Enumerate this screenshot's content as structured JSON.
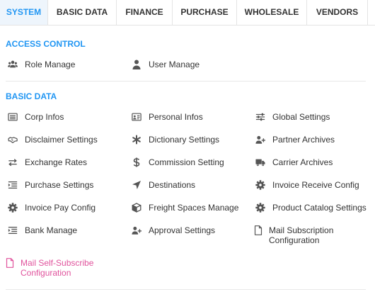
{
  "tabs": [
    {
      "label": "SYSTEM",
      "active": true
    },
    {
      "label": "BASIC DATA"
    },
    {
      "label": "FINANCE"
    },
    {
      "label": "PURCHASE"
    },
    {
      "label": "WHOLESALE"
    },
    {
      "label": "VENDORS"
    }
  ],
  "access_control": {
    "title": "ACCESS CONTROL",
    "items": [
      {
        "label": "Role Manage",
        "icon": "users-icon"
      },
      {
        "label": "User Manage",
        "icon": "user-icon"
      }
    ]
  },
  "basic_data": {
    "title": "BASIC DATA",
    "items": [
      {
        "label": "Corp Infos",
        "icon": "list-icon"
      },
      {
        "label": "Personal Infos",
        "icon": "id-card-icon"
      },
      {
        "label": "Global Settings",
        "icon": "sliders-icon"
      },
      {
        "label": "Disclaimer Settings",
        "icon": "handshake-icon"
      },
      {
        "label": "Dictionary Settings",
        "icon": "asterisk-icon"
      },
      {
        "label": "Partner Archives",
        "icon": "user-plus-icon"
      },
      {
        "label": "Exchange Rates",
        "icon": "exchange-icon"
      },
      {
        "label": "Commission Setting",
        "icon": "dollar-icon"
      },
      {
        "label": "Carrier Archives",
        "icon": "truck-icon"
      },
      {
        "label": "Purchase Settings",
        "icon": "indent-icon"
      },
      {
        "label": "Destinations",
        "icon": "location-arrow-icon"
      },
      {
        "label": "Invoice Receive Config",
        "icon": "gear-icon"
      },
      {
        "label": "Invoice Pay Config",
        "icon": "gear-icon"
      },
      {
        "label": "Freight Spaces Manage",
        "icon": "cube-icon"
      },
      {
        "label": "Product Catalog Settings",
        "icon": "gear-icon"
      },
      {
        "label": "Bank Manage",
        "icon": "indent-icon"
      },
      {
        "label": "Approval Settings",
        "icon": "user-plus-icon"
      },
      {
        "label": "Mail Subscription Configuration",
        "icon": "file-icon"
      },
      {
        "label": "Mail Self-Subscribe Configuration",
        "icon": "file-icon"
      }
    ]
  },
  "colors": {
    "accent": "#2196f3",
    "pink": "#e0529c",
    "text": "#333333",
    "icon": "#555555"
  }
}
